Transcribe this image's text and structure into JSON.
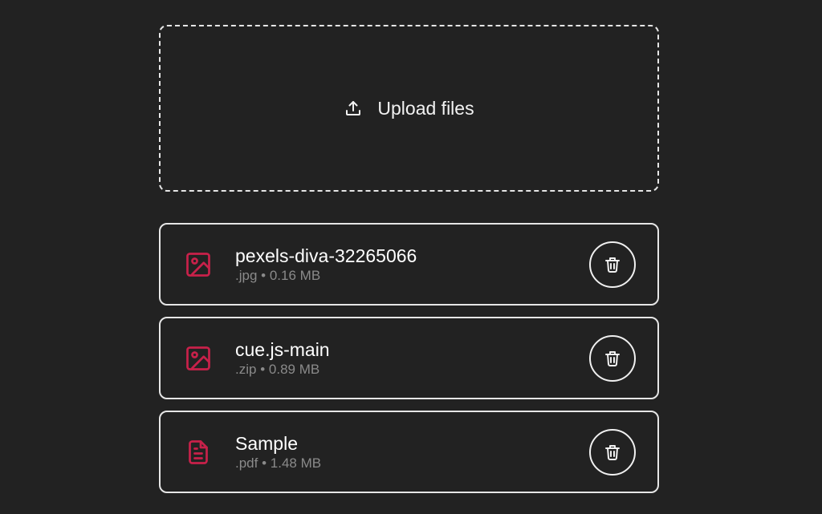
{
  "upload": {
    "label": "Upload files",
    "icon": "upload-icon"
  },
  "files": [
    {
      "name": "pexels-diva-32265066",
      "ext": ".jpg",
      "size": "0.16 MB",
      "icon": "image-icon"
    },
    {
      "name": "cue.js-main",
      "ext": ".zip",
      "size": "0.89 MB",
      "icon": "image-icon"
    },
    {
      "name": "Sample",
      "ext": ".pdf",
      "size": "1.48 MB",
      "icon": "document-icon"
    }
  ],
  "separator": "•",
  "colors": {
    "background": "#222222",
    "accent": "#c8214a",
    "border": "#e6e6e6",
    "meta_text": "#8a8a8a"
  }
}
